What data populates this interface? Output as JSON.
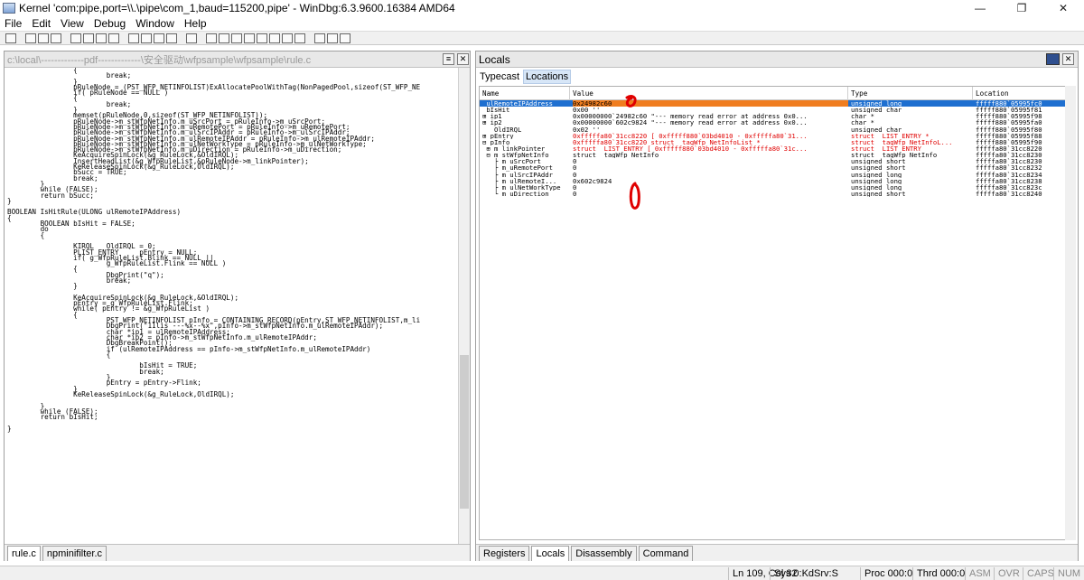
{
  "window": {
    "title": "Kernel 'com:pipe,port=\\\\.\\pipe\\com_1,baud=115200,pipe' - WinDbg:6.3.9600.16384 AMD64",
    "controls": [
      "—",
      "❐",
      "✕"
    ]
  },
  "menu": [
    "File",
    "Edit",
    "View",
    "Debug",
    "Window",
    "Help"
  ],
  "source": {
    "path": "c:\\local\\-------------pdf-------------\\安全驱动\\wfpsample\\wfpsample\\rule.c",
    "tabs": [
      {
        "label": "rule.c",
        "active": true
      },
      {
        "label": "npminifilter.c",
        "active": false
      }
    ],
    "lines": [
      "                {",
      "                        break;",
      "                }",
      "                pRuleNode = (PST_WFP_NETINFOLIST)ExAllocatePoolWithTag(NonPagedPool,sizeof(ST_WFP_NE",
      "                if( pRuleNode == NULL )",
      "                {",
      "                        break;",
      "                }",
      "                memset(pRuleNode,0,sizeof(ST_WFP_NETINFOLIST));",
      "                pRuleNode->m_stWfpNetInfo.m_uSrcPort = pRuleInfo->m_uSrcPort;",
      "                pRuleNode->m_stWfpNetInfo.m_uRemotePort = pRuleInfo->m_uRemotePort;",
      "                pRuleNode->m_stWfpNetInfo.m_ulSrcIPAddr = pRuleInfo->m_ulSrcIPAddr;",
      "                pRuleNode->m_stWfpNetInfo.m_ulRemoteIPAddr = pRuleInfo->m_ulRemoteIPAddr;",
      "                pRuleNode->m_stWfpNetInfo.m_ulNetWorkType = pRuleInfo->m_ulNetWorkType;",
      "                pRuleNode->m_stWfpNetInfo.m_uDirection = pRuleInfo->m_uDirection;",
      "                KeAcquireSpinLock(&g_RuleLock,&OldIRQL);",
      "                InsertHeadList(&g_WfpRuleList,&pRuleNode->m_linkPointer);",
      "                KeReleaseSpinLock(&g_RuleLock,OldIRQL);",
      "                bSucc = TRUE;",
      "                break;",
      "        }",
      "        while (FALSE);",
      "        return bSucc;",
      "}",
      "",
      "BOOLEAN IsHitRule(ULONG ulRemoteIPAddress)",
      "{",
      "        BOOLEAN bIsHit = FALSE;",
      "        do",
      "        {",
      "",
      "                KIRQL   OldIRQL = 0;",
      "                PLIST_ENTRY     pEntry = NULL;",
      "                if( g_WfpRuleList.Blink == NULL ||",
      "                        g_WfpRuleList.Flink == NULL )",
      "                {",
      "                        DbgPrint(\"q\");",
      "                        break;",
      "                }",
      "",
      "                KeAcquireSpinLock(&g_RuleLock,&OldIRQL);",
      "                pEntry = g_WfpRuleList.Flink;",
      "                while( pEntry != &g_WfpRuleList )",
      "                {",
      "                        PST_WFP_NETINFOLIST pInfo = CONTAINING_RECORD(pEntry,ST_WFP_NETINFOLIST,m_li",
      "                        DbgPrint(\"11lis ---%x--%x\",pInfo->m_stWfpNetInfo.m_ulRemoteIPAddr);",
      "                        char *ip1 = ulRemoteIPAddress;",
      "                        char *ip2 = pInfo->m_stWfpNetInfo.m_ulRemoteIPAddr;",
      "                        DbgBreakPoint();",
      "                        if (ulRemoteIPAddress == pInfo->m_stWfpNetInfo.m_ulRemoteIPAddr)",
      "                        {",
      "",
      "                                bIsHit = TRUE;",
      "                                break;",
      "                        }",
      "                        pEntry = pEntry->Flink;",
      "                }",
      "                KeReleaseSpinLock(&g_RuleLock,OldIRQL);",
      "",
      "        }",
      "        while (FALSE);",
      "        return bIsHit;",
      "",
      "}"
    ]
  },
  "locals": {
    "title": "Locals",
    "subtabs": [
      {
        "label": "Typecast",
        "selected": false
      },
      {
        "label": "Locations",
        "selected": true
      }
    ],
    "columns": [
      "Name",
      "Value",
      "Type",
      "Location"
    ],
    "rows": [
      {
        "name": " ulRemoteIPAddress",
        "value": "0x24982c60",
        "type": "unsigned long",
        "loc": "fffff880`05995fc0",
        "selected": true,
        "red": false
      },
      {
        "name": " bIsHit",
        "value": "0x00 ''",
        "type": "unsigned char",
        "loc": "fffff880`05995f81",
        "selected": false,
        "red": false
      },
      {
        "name": "⊞ ip1",
        "value": "0x00000000`24982c60 \"--- memory read error at address 0x0...",
        "type": "char *",
        "loc": "fffff880`05995f98",
        "selected": false,
        "red": false
      },
      {
        "name": "⊞ ip2",
        "value": "0x00000000`602c9824 \"--- memory read error at address 0x0...",
        "type": "char *",
        "loc": "fffff880`05995fa0",
        "selected": false,
        "red": false
      },
      {
        "name": "   OldIRQL",
        "value": "0x02 ''",
        "type": "unsigned char",
        "loc": "fffff880`05995f80",
        "selected": false,
        "red": false
      },
      {
        "name": "⊞ pEntry",
        "value": "0xfffffa80`31cc8220 [ 0xfffff880`03bd4010 - 0xfffffa80`31...",
        "type": "struct _LIST_ENTRY *",
        "loc": "fffff880`05995f88",
        "selected": false,
        "red": true
      },
      {
        "name": "⊟ pInfo",
        "value": "0xfffffa80`31cc8220 struct _tagWfp_NetInfoList *",
        "type": "struct _tagWfp_NetInfoL...",
        "loc": "fffff880`05995f90",
        "selected": false,
        "red": true
      },
      {
        "name": " ⊞ m_linkPointer",
        "value": "struct _LIST_ENTRY [ 0xfffff880`03bd4010 - 0xfffffa80`31c...",
        "type": "struct _LIST_ENTRY",
        "loc": "fffffa80`31cc8220",
        "selected": false,
        "red": true
      },
      {
        "name": " ⊟ m_stWfpNetInfo",
        "value": "struct _tagWfp_NetInfo",
        "type": "struct _tagWfp_NetInfo",
        "loc": "fffffa80`31cc8230",
        "selected": false,
        "red": false
      },
      {
        "name": "   ├ m_uSrcPort",
        "value": "0",
        "type": "unsigned short",
        "loc": "fffffa80`31cc8230",
        "selected": false,
        "red": false
      },
      {
        "name": "   ├ m_uRemotePort",
        "value": "0",
        "type": "unsigned short",
        "loc": "fffffa80`31cc8232",
        "selected": false,
        "red": false
      },
      {
        "name": "   ├ m_ulSrcIPAddr",
        "value": "0",
        "type": "unsigned long",
        "loc": "fffffa80`31cc8234",
        "selected": false,
        "red": false
      },
      {
        "name": "   ├ m_ulRemoteI...",
        "value": "0x602c9824",
        "type": "unsigned long",
        "loc": "fffffa80`31cc8238",
        "selected": false,
        "red": false
      },
      {
        "name": "   ├ m_ulNetWorkType",
        "value": "0",
        "type": "unsigned long",
        "loc": "fffffa80`31cc823c",
        "selected": false,
        "red": false
      },
      {
        "name": "   └ m_uDirection",
        "value": "0",
        "type": "unsigned short",
        "loc": "fffffa80`31cc8240",
        "selected": false,
        "red": false
      }
    ],
    "bottom_tabs": [
      {
        "label": "Registers",
        "active": false
      },
      {
        "label": "Locals",
        "active": true
      },
      {
        "label": "Disassembly",
        "active": false
      },
      {
        "label": "Command",
        "active": false
      }
    ]
  },
  "status": {
    "position": "Ln 109, Col 32",
    "session": "Sys 0:KdSrv:S",
    "process": "Proc 000:0",
    "thread": "Thrd 000:0",
    "asm": "ASM",
    "ovr": "OVR",
    "caps": "CAPS",
    "num": "NUM"
  },
  "colors": {
    "selection": "#1e6fd0",
    "highlight": "#f07d1f",
    "error_red": "#e00000",
    "keyword_blue": "#0000ff"
  }
}
